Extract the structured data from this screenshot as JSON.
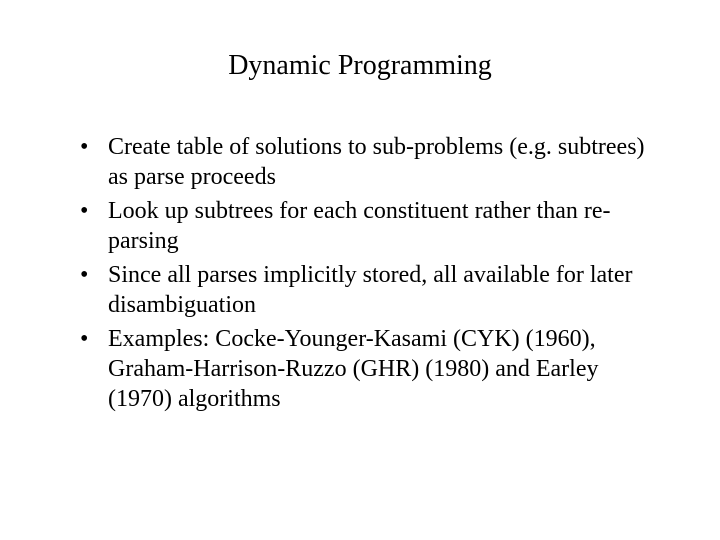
{
  "slide": {
    "title": "Dynamic Programming",
    "bullets": [
      "Create table of solutions to sub-problems (e.g. subtrees) as parse proceeds",
      "Look up subtrees for each constituent rather than re-parsing",
      "Since all parses implicitly stored, all available for later disambiguation",
      "Examples: Cocke-Younger-Kasami (CYK) (1960), Graham-Harrison-Ruzzo (GHR) (1980) and Earley (1970) algorithms"
    ]
  }
}
